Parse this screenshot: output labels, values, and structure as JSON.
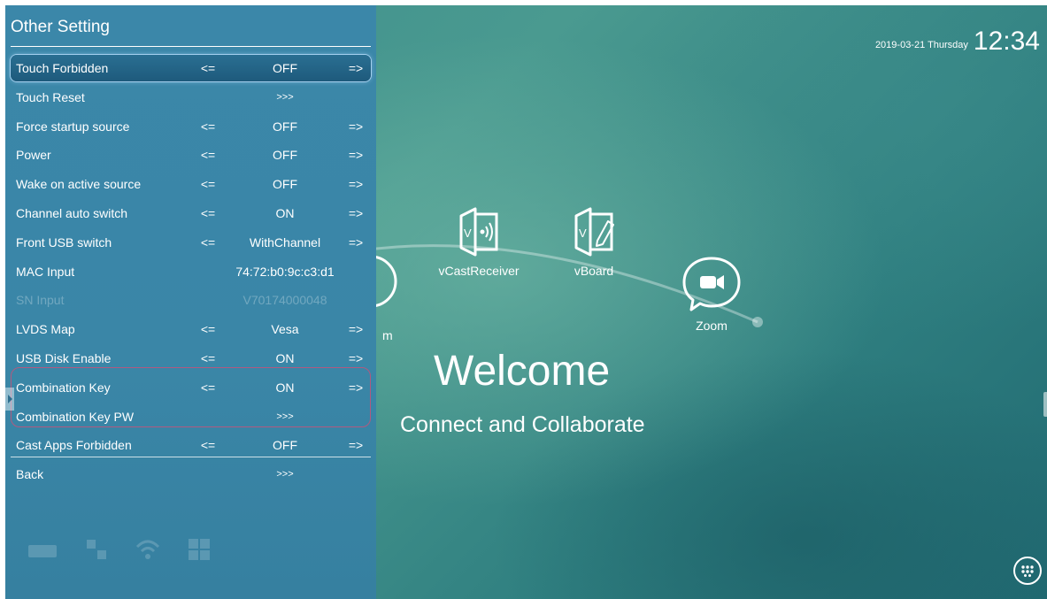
{
  "panel": {
    "title": "Other Setting",
    "rows": [
      {
        "label": "Touch Forbidden",
        "left_arrow": "<=",
        "value": "OFF",
        "right_arrow": "=>"
      },
      {
        "label": "Touch Reset",
        "enter": ">>>"
      },
      {
        "label": "Force startup source",
        "left_arrow": "<=",
        "value": "OFF",
        "right_arrow": "=>"
      },
      {
        "label": "Power",
        "left_arrow": "<=",
        "value": "OFF",
        "right_arrow": "=>"
      },
      {
        "label": "Wake on active source",
        "left_arrow": "<=",
        "value": "OFF",
        "right_arrow": "=>"
      },
      {
        "label": "Channel auto switch",
        "left_arrow": "<=",
        "value": "ON",
        "right_arrow": "=>"
      },
      {
        "label": "Front USB switch",
        "left_arrow": "<=",
        "value": "WithChannel",
        "right_arrow": "=>"
      },
      {
        "label": "MAC Input",
        "value": "74:72:b0:9c:c3:d1"
      },
      {
        "label": "SN Input",
        "value": "V70174000048"
      },
      {
        "label": "LVDS Map",
        "left_arrow": "<=",
        "value": "Vesa",
        "right_arrow": "=>"
      },
      {
        "label": "USB Disk Enable",
        "left_arrow": "<=",
        "value": "ON",
        "right_arrow": "=>"
      },
      {
        "label": "Combination Key",
        "left_arrow": "<=",
        "value": "ON",
        "right_arrow": "=>"
      },
      {
        "label": "Combination Key PW",
        "enter": ">>>"
      },
      {
        "label": "Cast Apps Forbidden",
        "left_arrow": "<=",
        "value": "OFF",
        "right_arrow": "=>"
      },
      {
        "label": "Back",
        "enter": ">>>"
      }
    ]
  },
  "desktop": {
    "date": "2019-03-21 Thursday",
    "time": "12:34",
    "apps": [
      {
        "label": "vCastReceiver",
        "icon": "vcast-receiver-icon"
      },
      {
        "label": "vBoard",
        "icon": "vboard-icon"
      },
      {
        "label": "Zoom",
        "icon": "zoom-icon"
      }
    ],
    "partial_app_label": "m",
    "welcome": "Welcome",
    "tagline": "Connect and Collaborate"
  },
  "colors": {
    "panel_background": "#3a86a7",
    "selected_row": "#1e5a7c",
    "group_outline": "#b05a80",
    "desktop_teal": "#3d8e8c"
  }
}
